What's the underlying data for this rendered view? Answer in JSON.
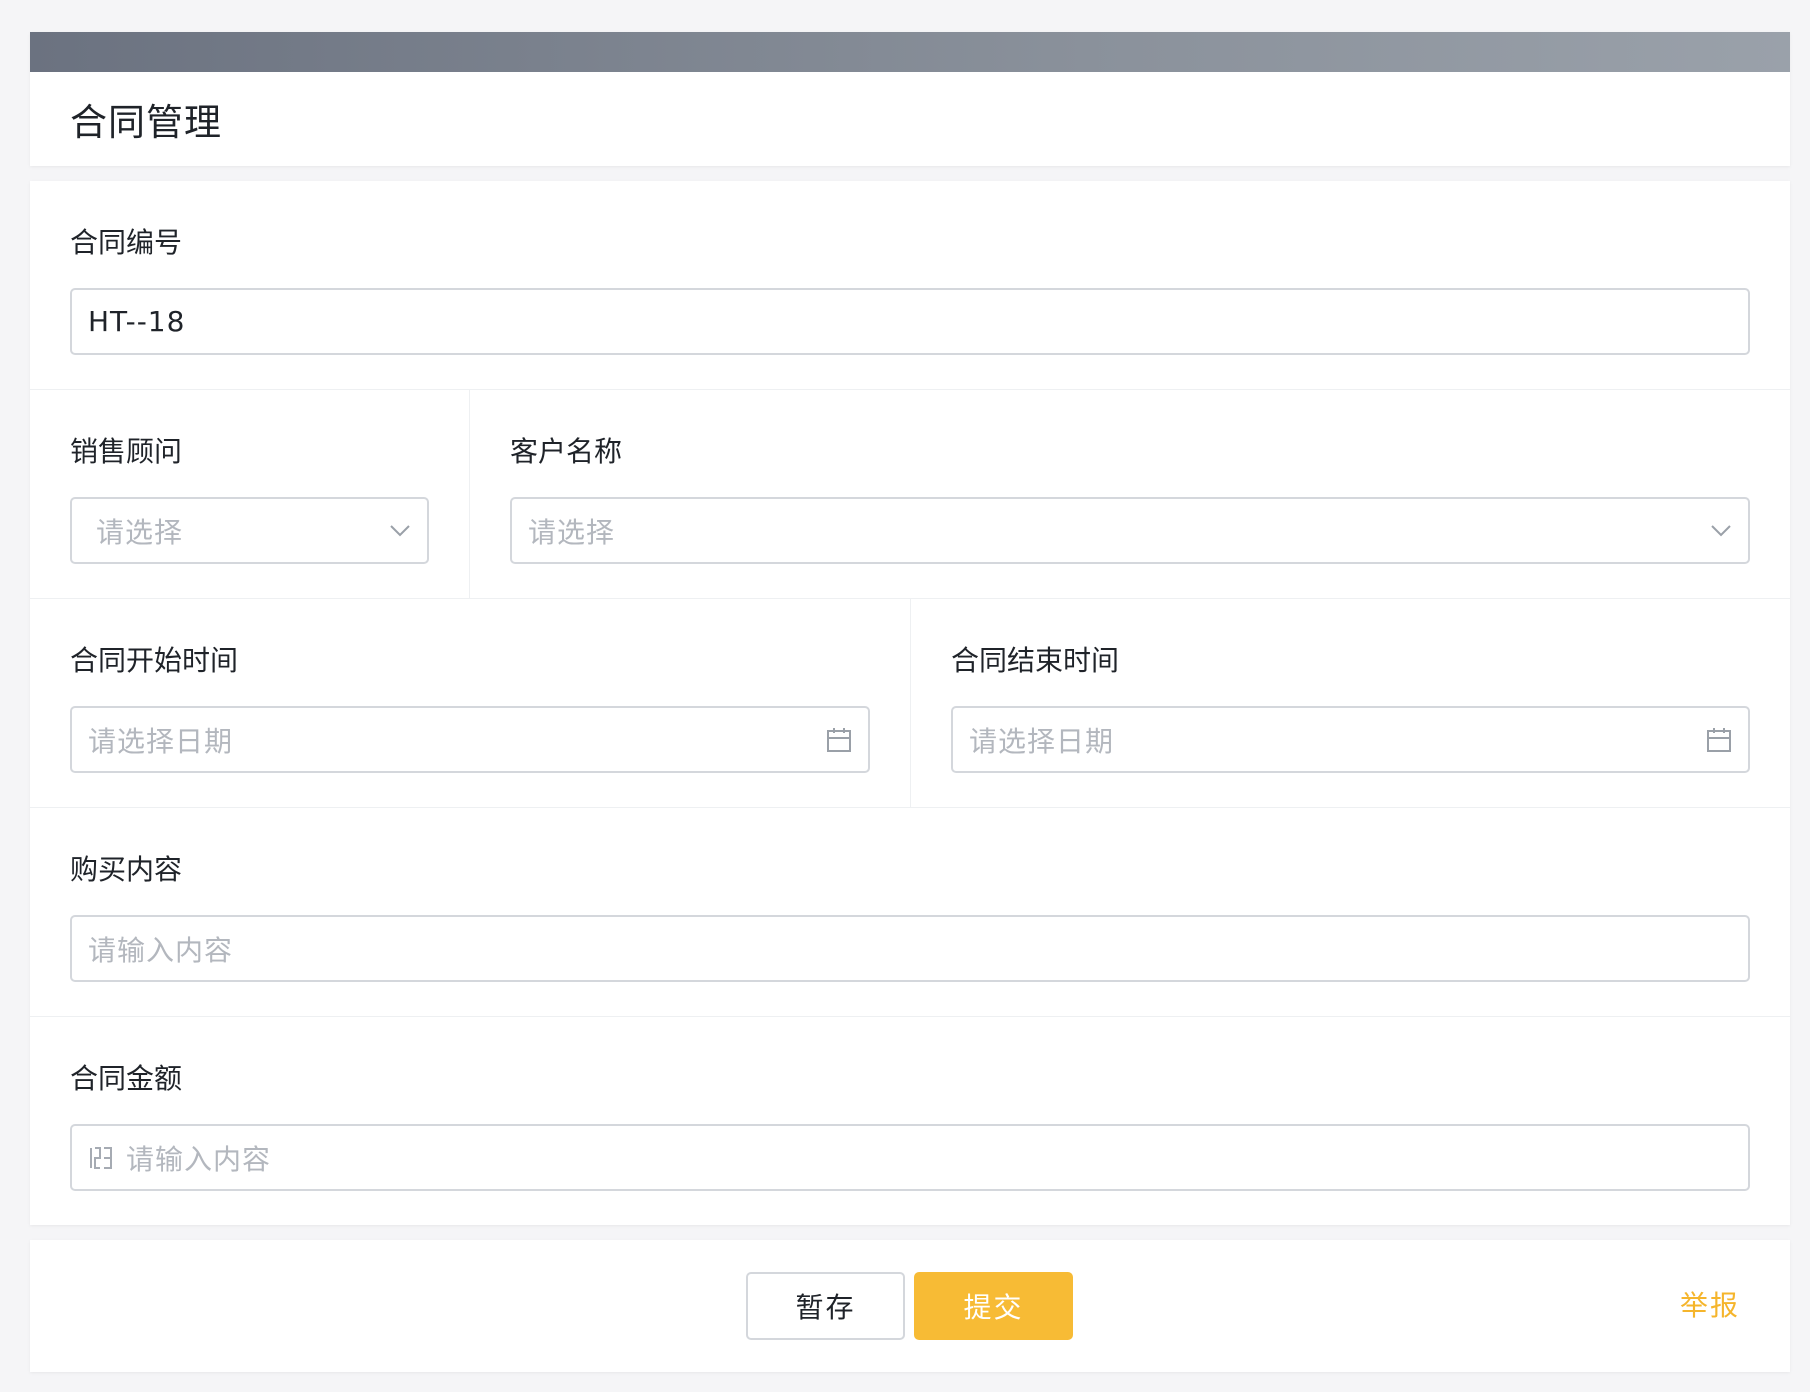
{
  "header": {
    "title": "合同管理"
  },
  "form": {
    "contract_no": {
      "label": "合同编号",
      "value": "HT--18"
    },
    "sales_consultant": {
      "label": "销售顾问",
      "placeholder": "请选择",
      "icon": "chevron-down-icon"
    },
    "customer_name": {
      "label": "客户名称",
      "placeholder": "请选择",
      "icon": "chevron-down-icon"
    },
    "start_date": {
      "label": "合同开始时间",
      "placeholder": "请选择日期",
      "icon": "calendar-icon"
    },
    "end_date": {
      "label": "合同结束时间",
      "placeholder": "请选择日期",
      "icon": "calendar-icon"
    },
    "purchase_content": {
      "label": "购买内容",
      "placeholder": "请输入内容"
    },
    "contract_amount": {
      "label": "合同金额",
      "placeholder": "请输入内容",
      "icon": "number-icon"
    }
  },
  "footer": {
    "save_label": "暂存",
    "submit_label": "提交",
    "report_label": "举报"
  },
  "colors": {
    "accent": "#f7bb35",
    "report_link": "#f5b52c",
    "header_bar": "#6b7280",
    "placeholder": "#b3b7be",
    "border": "#d4d7dc"
  }
}
